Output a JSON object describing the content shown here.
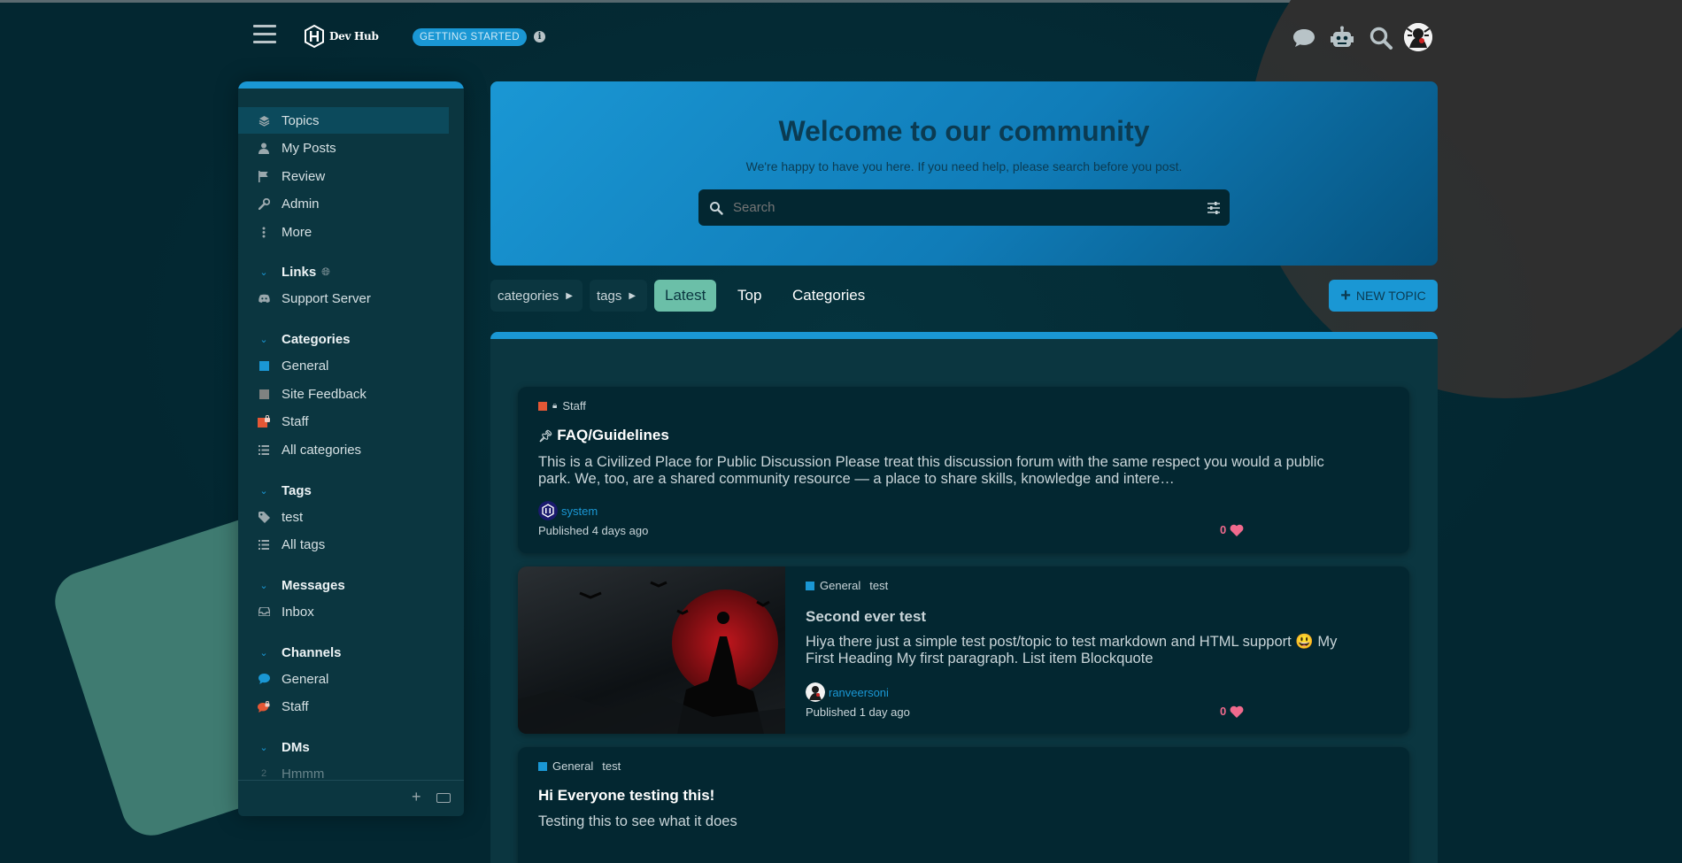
{
  "colors": {
    "background": "#032731",
    "panel": "#0b3640",
    "accent": "#1a97d4",
    "latest_active": "#6bbfa8",
    "like": "#f06a8d",
    "staff_category": "#e45735",
    "general_category": "#1a97d4",
    "site_feedback_category": "#808281"
  },
  "header": {
    "logo_text": "Dev Hub",
    "getting_started": "GETTING STARTED",
    "icons": [
      "menu-icon",
      "info-icon",
      "chat-icon",
      "robot-icon",
      "search-icon",
      "user-avatar"
    ]
  },
  "sidebar": {
    "main": [
      {
        "label": "Topics",
        "icon": "layers-icon"
      },
      {
        "label": "My Posts",
        "icon": "user-icon"
      },
      {
        "label": "Review",
        "icon": "flag-icon"
      },
      {
        "label": "Admin",
        "icon": "wrench-icon"
      },
      {
        "label": "More",
        "icon": "ellipsis-icon"
      }
    ],
    "links": {
      "title": "Links",
      "items": [
        {
          "label": "Support Server",
          "icon": "discord-icon"
        }
      ]
    },
    "categories": {
      "title": "Categories",
      "items": [
        {
          "label": "General"
        },
        {
          "label": "Site Feedback"
        },
        {
          "label": "Staff"
        },
        {
          "label": "All categories"
        }
      ]
    },
    "tags": {
      "title": "Tags",
      "items": [
        {
          "label": "test"
        },
        {
          "label": "All tags"
        }
      ]
    },
    "messages": {
      "title": "Messages",
      "items": [
        {
          "label": "Inbox"
        }
      ]
    },
    "channels": {
      "title": "Channels",
      "items": [
        {
          "label": "General"
        },
        {
          "label": "Staff"
        }
      ]
    },
    "dms": {
      "title": "DMs",
      "items": [
        {
          "label": "Hmmm",
          "count": "2"
        }
      ]
    }
  },
  "hero": {
    "title": "Welcome to our community",
    "subtitle": "We're happy to have you here. If you need help, please search before you post.",
    "search_placeholder": "Search"
  },
  "nav": {
    "categories": "categories",
    "tags": "tags",
    "latest": "Latest",
    "top": "Top",
    "categories_link": "Categories",
    "new_topic": "NEW TOPIC"
  },
  "topics": [
    {
      "category": "Staff",
      "title": "FAQ/Guidelines",
      "excerpt_line1": "This is a Civilized Place for Public Discussion Please treat this discussion forum with the same respect you would a public",
      "excerpt_line2": "park. We, too, are a shared community resource — a place to share skills, knowledge and intere…",
      "author": "system",
      "published": "Published 4 days ago",
      "likes": "0"
    },
    {
      "category": "General",
      "tag": "test",
      "title": "Second ever test",
      "excerpt_line1": "Hiya there just a simple test post/topic to test markdown and HTML support 😃 My",
      "excerpt_line2": "First Heading My first paragraph. List item Blockquote",
      "author": "ranveersoni",
      "published": "Published 1 day ago",
      "likes": "0"
    },
    {
      "category": "General",
      "tag": "test",
      "title": "Hi Everyone testing this!",
      "excerpt_line1": "Testing this to see what it does"
    }
  ]
}
